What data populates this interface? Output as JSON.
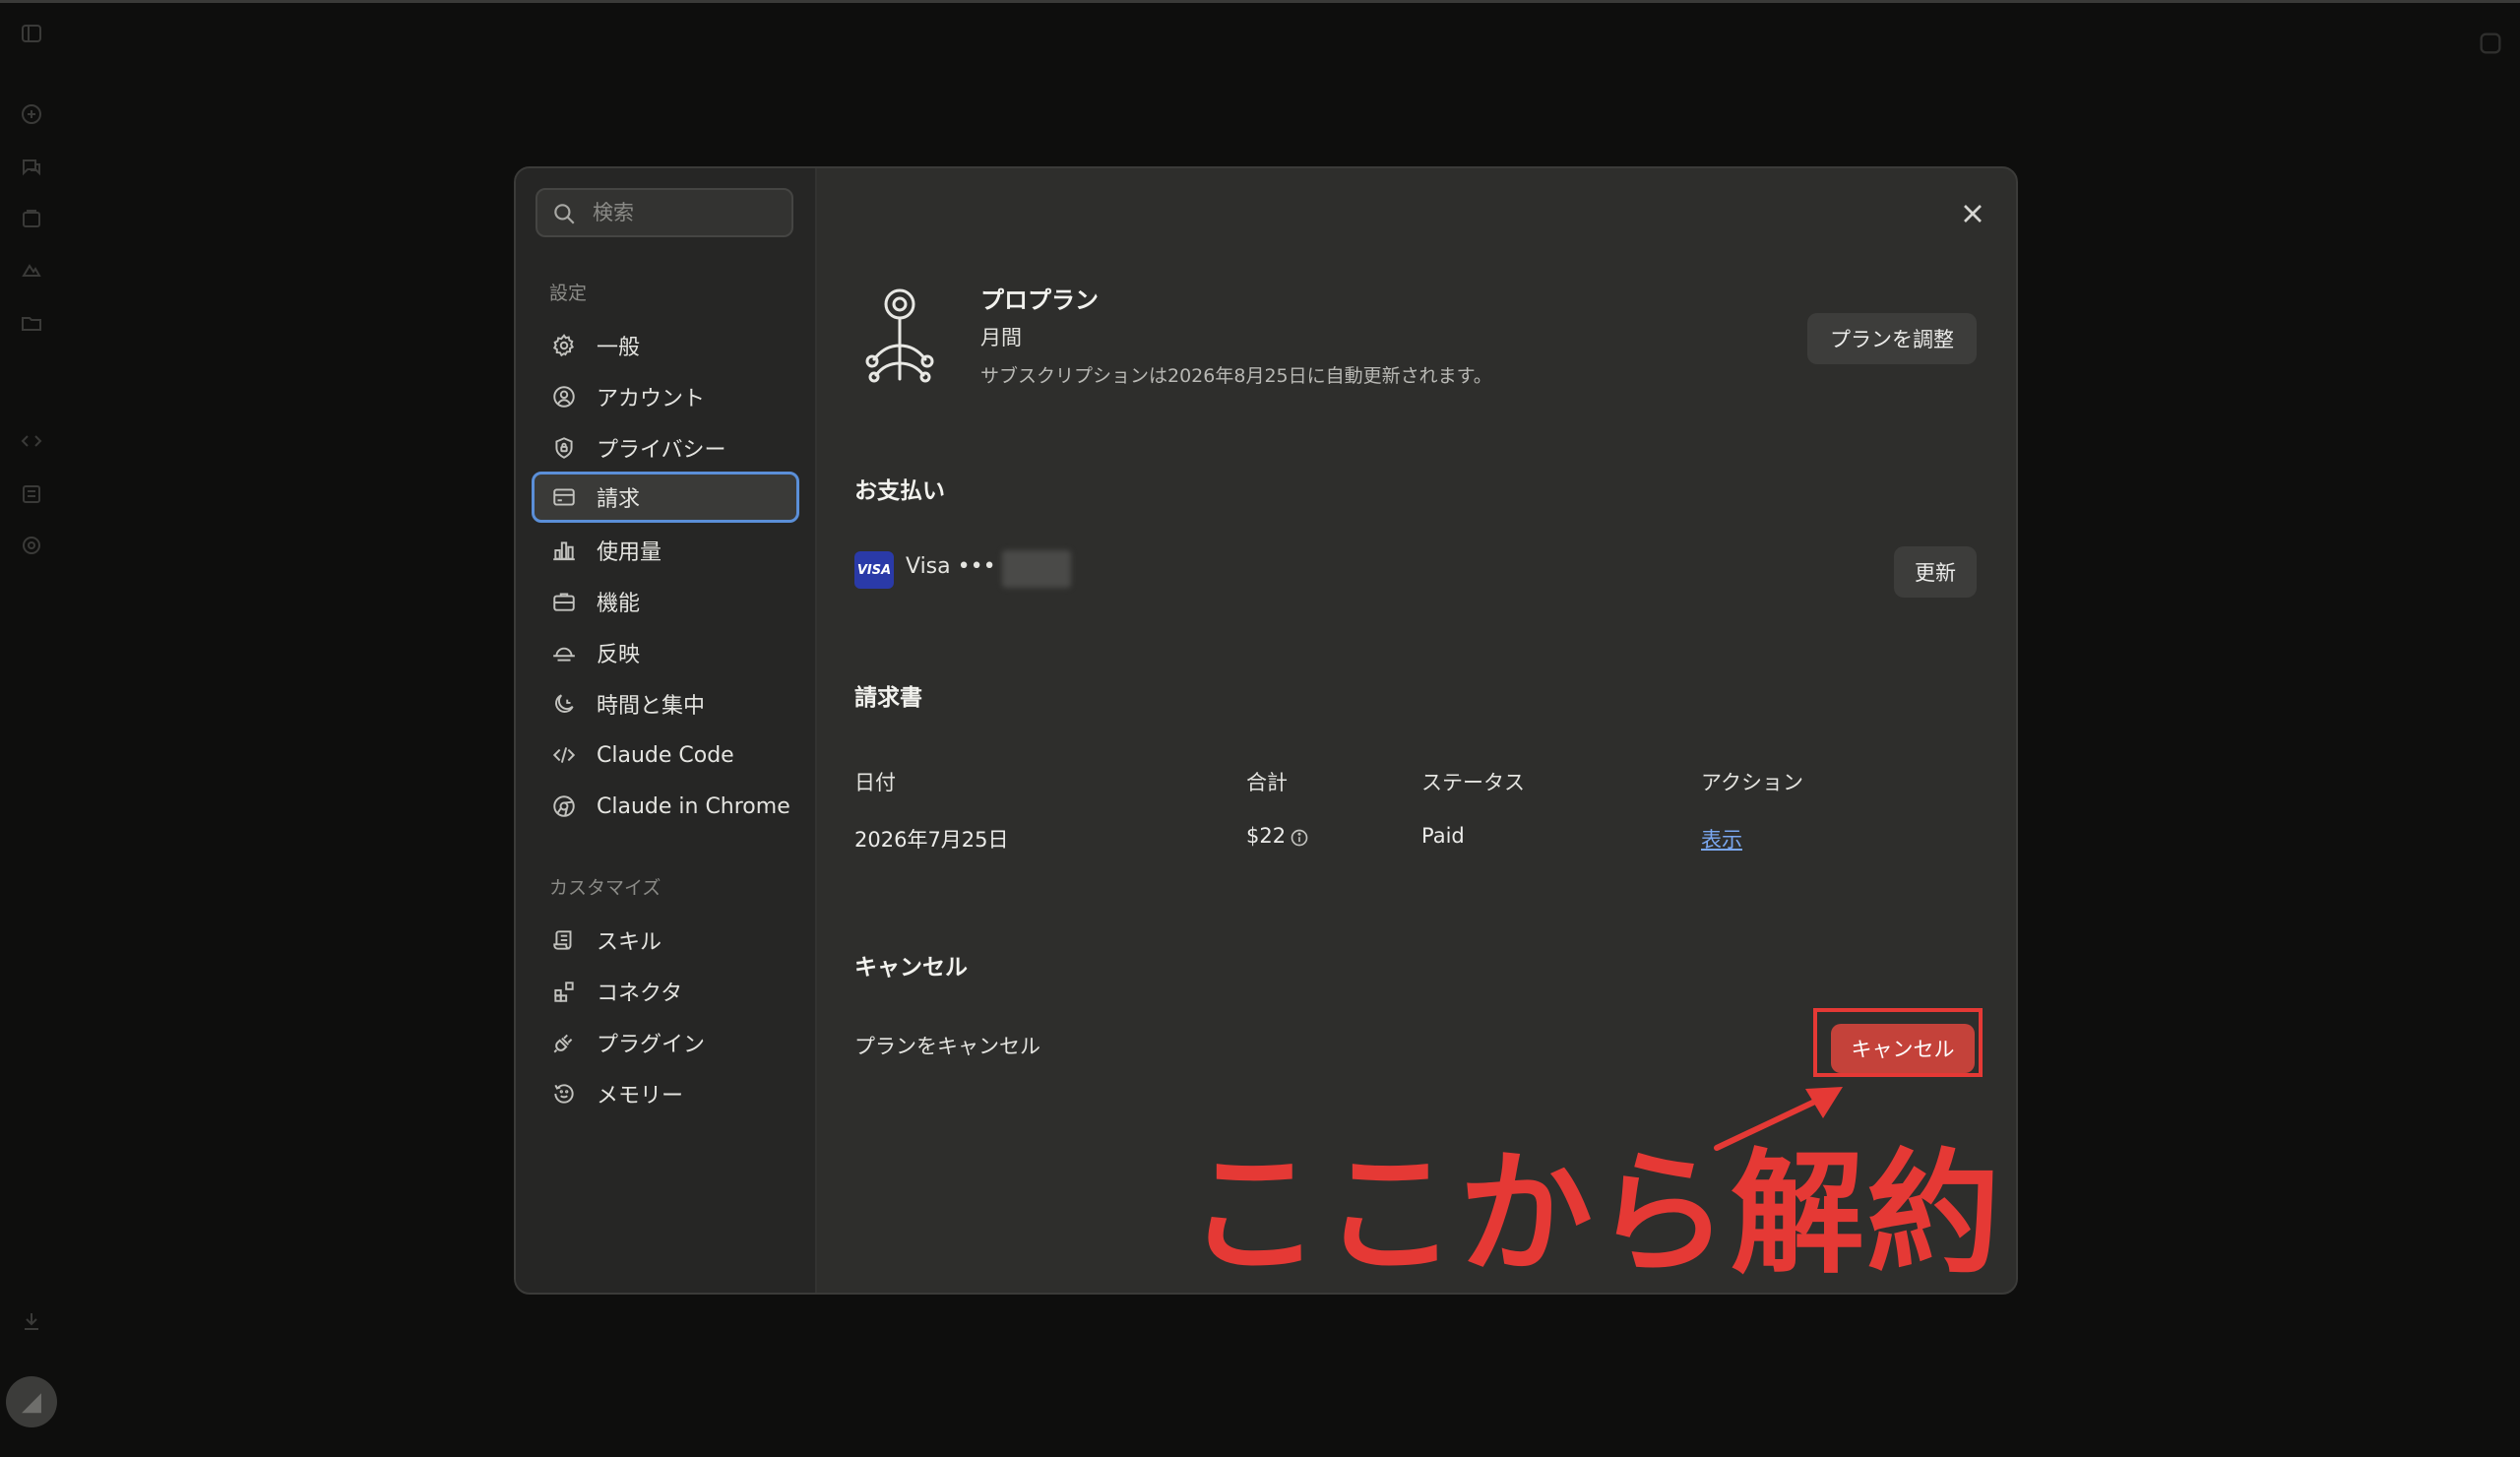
{
  "search": {
    "placeholder": "検索"
  },
  "nav": {
    "settings_heading": "設定",
    "settings_items": [
      {
        "label": "一般",
        "icon": "gear-icon"
      },
      {
        "label": "アカウント",
        "icon": "user-circle-icon"
      },
      {
        "label": "プライバシー",
        "icon": "shield-icon"
      },
      {
        "label": "請求",
        "icon": "credit-card-icon",
        "active": true
      },
      {
        "label": "使用量",
        "icon": "bar-chart-icon"
      },
      {
        "label": "機能",
        "icon": "briefcase-icon"
      },
      {
        "label": "反映",
        "icon": "sunrise-icon"
      },
      {
        "label": "時間と集中",
        "icon": "moon-icon"
      },
      {
        "label": "Claude Code",
        "icon": "code-icon"
      },
      {
        "label": "Claude in Chrome",
        "icon": "globe-icon"
      }
    ],
    "customize_heading": "カスタマイズ",
    "customize_items": [
      {
        "label": "スキル",
        "icon": "scroll-icon"
      },
      {
        "label": "コネクタ",
        "icon": "blocks-icon"
      },
      {
        "label": "プラグイン",
        "icon": "plug-icon"
      },
      {
        "label": "メモリー",
        "icon": "history-icon"
      }
    ]
  },
  "plan": {
    "title": "プロプラン",
    "cycle": "月間",
    "renewal": "サブスクリプションは2026年8月25日に自動更新されます。",
    "adjust_label": "プランを調整"
  },
  "payment": {
    "heading": "お支払い",
    "card_brand_badge": "VISA",
    "card_label": "Visa •••",
    "update_label": "更新"
  },
  "invoices": {
    "heading": "請求書",
    "columns": [
      "日付",
      "合計",
      "ステータス",
      "アクション"
    ],
    "rows": [
      {
        "date": "2026年7月25日",
        "total": "$22",
        "status": "Paid",
        "action": "表示"
      }
    ]
  },
  "cancel": {
    "heading": "キャンセル",
    "description": "プランをキャンセル",
    "button_label": "キャンセル"
  },
  "annotation": {
    "text": "ここから解約",
    "color": "#e53935"
  },
  "colors": {
    "accent_focus": "#5b8fd8",
    "cancel_button": "#c4423a",
    "link": "#7aa7f0"
  }
}
